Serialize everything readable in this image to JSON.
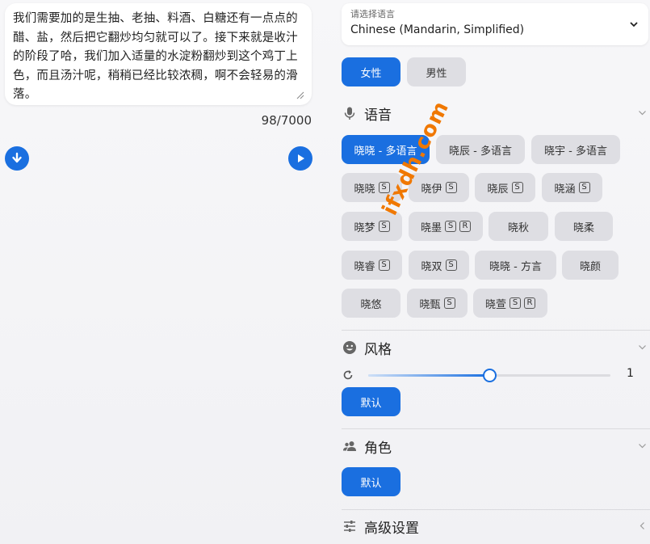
{
  "editor": {
    "text": "我们需要加的是生抽、老抽、料酒、白糖还有一点点的醋、盐，然后把它翻炒均匀就可以了。接下来就是收汁的阶段了哈，我们加入适量的水淀粉翻炒到这个鸡丁上色，而且汤汁呢，稍稍已经比较浓稠，啊不会轻易的滑落。",
    "counter": "98/7000"
  },
  "language": {
    "label": "请选择语言",
    "value": "Chinese (Mandarin, Simplified)"
  },
  "gender": {
    "options": [
      "女性",
      "男性"
    ],
    "selected": "女性"
  },
  "voice": {
    "title": "语音",
    "options": [
      {
        "name": "晓晓 - 多语言",
        "tags": [],
        "active": true
      },
      {
        "name": "晓辰 - 多语言",
        "tags": []
      },
      {
        "name": "晓宇 - 多语言",
        "tags": []
      },
      {
        "name": "晓晓",
        "tags": [
          "S"
        ]
      },
      {
        "name": "晓伊",
        "tags": [
          "S"
        ]
      },
      {
        "name": "晓辰",
        "tags": [
          "S"
        ]
      },
      {
        "name": "晓涵",
        "tags": [
          "S"
        ]
      },
      {
        "name": "晓梦",
        "tags": [
          "S"
        ]
      },
      {
        "name": "晓墨",
        "tags": [
          "S",
          "R"
        ]
      },
      {
        "name": "晓秋",
        "tags": []
      },
      {
        "name": "晓柔",
        "tags": []
      },
      {
        "name": "晓睿",
        "tags": [
          "S"
        ]
      },
      {
        "name": "晓双",
        "tags": [
          "S"
        ]
      },
      {
        "name": "晓晓 - 方言",
        "tags": []
      },
      {
        "name": "晓颜",
        "tags": []
      },
      {
        "name": "晓悠",
        "tags": []
      },
      {
        "name": "晓甄",
        "tags": [
          "S"
        ]
      },
      {
        "name": "晓萱",
        "tags": [
          "S",
          "R"
        ]
      }
    ]
  },
  "style": {
    "title": "风格",
    "intensity_value": "1",
    "intensity_fraction": 0.5,
    "button": "默认"
  },
  "role": {
    "title": "角色",
    "button": "默认"
  },
  "advanced": {
    "title": "高级设置"
  },
  "watermark": "ifxdh.com",
  "colors": {
    "accent": "#1a6fe0",
    "chip": "#dedee3",
    "watermark": "#f07800"
  }
}
